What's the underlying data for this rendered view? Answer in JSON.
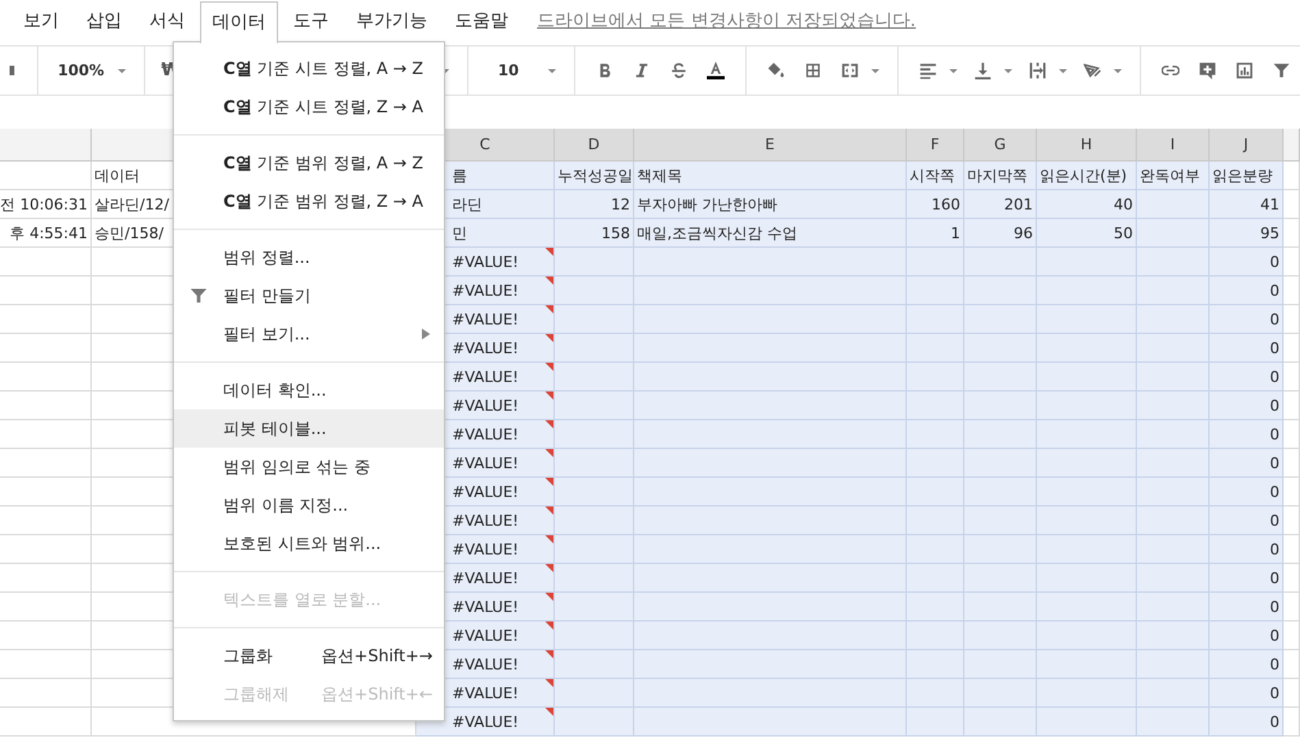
{
  "menu_bar": [
    {
      "label": "보기",
      "selected": false
    },
    {
      "label": "삽입",
      "selected": false
    },
    {
      "label": "서식",
      "selected": false
    },
    {
      "label": "데이터",
      "selected": true
    },
    {
      "label": "도구",
      "selected": false
    },
    {
      "label": "부가기능",
      "selected": false
    },
    {
      "label": "도움말",
      "selected": false
    }
  ],
  "save_status": "드라이브에서 모든 변경사항이 저장되었습니다.",
  "toolbar": {
    "zoom": "100%",
    "currency": "₩",
    "font_size": "10"
  },
  "sheet": {
    "columns": [
      {
        "selected": false
      },
      {
        "selected": false
      },
      {
        "letter": "C",
        "selected": true
      },
      {
        "letter": "D",
        "selected": true
      },
      {
        "letter": "E",
        "selected": true
      },
      {
        "letter": "F",
        "selected": true
      },
      {
        "letter": "G",
        "selected": true
      },
      {
        "letter": "H",
        "selected": true
      },
      {
        "letter": "I",
        "selected": true
      },
      {
        "letter": "J",
        "selected": true
      }
    ],
    "rows": [
      {
        "error": false,
        "cells": [
          null,
          "데이터",
          "름",
          "누적성공일",
          "책제목",
          "시작쪽",
          "마지막쪽",
          "읽은시간(분)",
          "완독여부",
          "읽은분량"
        ]
      },
      {
        "error": false,
        "cells": [
          "전 10:06:31",
          "살라딘/12/",
          "라딘",
          "12",
          "부자아빠 가난한아빠",
          "160",
          "201",
          "40",
          null,
          "41"
        ]
      },
      {
        "error": false,
        "cells": [
          "후 4:55:41",
          "승민/158/",
          "민",
          "158",
          "매일,조금씩자신감 수업",
          "1",
          "96",
          "50",
          null,
          "95"
        ]
      },
      {
        "error": true,
        "cells": [
          null,
          null,
          "#VALUE!",
          null,
          null,
          null,
          null,
          null,
          null,
          "0"
        ]
      },
      {
        "error": true,
        "cells": [
          null,
          null,
          "#VALUE!",
          null,
          null,
          null,
          null,
          null,
          null,
          "0"
        ]
      },
      {
        "error": true,
        "cells": [
          null,
          null,
          "#VALUE!",
          null,
          null,
          null,
          null,
          null,
          null,
          "0"
        ]
      },
      {
        "error": true,
        "cells": [
          null,
          null,
          "#VALUE!",
          null,
          null,
          null,
          null,
          null,
          null,
          "0"
        ]
      },
      {
        "error": true,
        "cells": [
          null,
          null,
          "#VALUE!",
          null,
          null,
          null,
          null,
          null,
          null,
          "0"
        ]
      },
      {
        "error": true,
        "cells": [
          null,
          null,
          "#VALUE!",
          null,
          null,
          null,
          null,
          null,
          null,
          "0"
        ]
      },
      {
        "error": true,
        "cells": [
          null,
          null,
          "#VALUE!",
          null,
          null,
          null,
          null,
          null,
          null,
          "0"
        ]
      },
      {
        "error": true,
        "cells": [
          null,
          null,
          "#VALUE!",
          null,
          null,
          null,
          null,
          null,
          null,
          "0"
        ]
      },
      {
        "error": true,
        "cells": [
          null,
          null,
          "#VALUE!",
          null,
          null,
          null,
          null,
          null,
          null,
          "0"
        ]
      },
      {
        "error": true,
        "cells": [
          null,
          null,
          "#VALUE!",
          null,
          null,
          null,
          null,
          null,
          null,
          "0"
        ]
      },
      {
        "error": true,
        "cells": [
          null,
          null,
          "#VALUE!",
          null,
          null,
          null,
          null,
          null,
          null,
          "0"
        ]
      },
      {
        "error": true,
        "cells": [
          null,
          null,
          "#VALUE!",
          null,
          null,
          null,
          null,
          null,
          null,
          "0"
        ]
      },
      {
        "error": true,
        "cells": [
          null,
          null,
          "#VALUE!",
          null,
          null,
          null,
          null,
          null,
          null,
          "0"
        ]
      },
      {
        "error": true,
        "cells": [
          null,
          null,
          "#VALUE!",
          null,
          null,
          null,
          null,
          null,
          null,
          "0"
        ]
      },
      {
        "error": true,
        "cells": [
          null,
          null,
          "#VALUE!",
          null,
          null,
          null,
          null,
          null,
          null,
          "0"
        ]
      },
      {
        "error": true,
        "cells": [
          null,
          null,
          "#VALUE!",
          null,
          null,
          null,
          null,
          null,
          null,
          "0"
        ]
      },
      {
        "error": true,
        "cells": [
          null,
          null,
          "#VALUE!",
          null,
          null,
          null,
          null,
          null,
          null,
          "0"
        ]
      }
    ]
  },
  "data_menu": {
    "groups": [
      [
        {
          "label": "**C열** 기준 시트 정렬, A → Z",
          "selected": false,
          "disabled": false,
          "icon": false,
          "submenu": false
        },
        {
          "label": "**C열** 기준 시트 정렬, Z → A",
          "selected": false,
          "disabled": false,
          "icon": false,
          "submenu": false
        }
      ],
      [
        {
          "label": "**C열** 기준 범위 정렬, A → Z",
          "selected": false,
          "disabled": false,
          "icon": false,
          "submenu": false
        },
        {
          "label": "**C열** 기준 범위 정렬, Z → A",
          "selected": false,
          "disabled": false,
          "icon": false,
          "submenu": false
        }
      ],
      [
        {
          "label": "범위 정렬...",
          "selected": false,
          "disabled": false,
          "icon": false,
          "submenu": false
        },
        {
          "label": "필터 만들기",
          "selected": false,
          "disabled": false,
          "icon": true,
          "submenu": false
        },
        {
          "label": "필터 보기...",
          "selected": false,
          "disabled": false,
          "icon": false,
          "submenu": true
        }
      ],
      [
        {
          "label": "데이터 확인...",
          "selected": false,
          "disabled": false,
          "icon": false,
          "submenu": false
        },
        {
          "label": "피봇 테이블...",
          "selected": true,
          "disabled": false,
          "icon": false,
          "submenu": false
        },
        {
          "label": "범위 임의로 섞는 중",
          "selected": false,
          "disabled": false,
          "icon": false,
          "submenu": false
        },
        {
          "label": "범위 이름 지정...",
          "selected": false,
          "disabled": false,
          "icon": false,
          "submenu": false
        },
        {
          "label": "보호된 시트와 범위...",
          "selected": false,
          "disabled": false,
          "icon": false,
          "submenu": false
        }
      ],
      [
        {
          "label": "텍스트를 열로 분할...",
          "selected": false,
          "disabled": true,
          "icon": false,
          "submenu": false
        }
      ],
      [
        {
          "label": "그룹화",
          "shortcut": "옵션+Shift+→",
          "selected": false,
          "disabled": false,
          "icon": false,
          "submenu": false
        },
        {
          "label": "그룹해제",
          "shortcut": "옵션+Shift+←",
          "selected": false,
          "disabled": true,
          "icon": false,
          "submenu": false
        }
      ]
    ]
  }
}
